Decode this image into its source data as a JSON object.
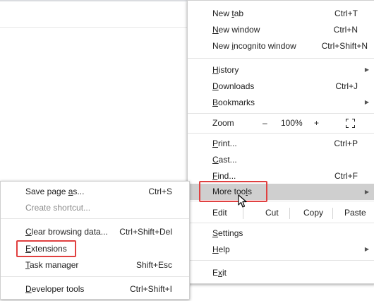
{
  "main_menu": {
    "new_tab": {
      "pre": "New ",
      "u": "t",
      "post": "ab",
      "shortcut": "Ctrl+T"
    },
    "new_window": {
      "pre": "",
      "u": "N",
      "post": "ew window",
      "shortcut": "Ctrl+N"
    },
    "new_incognito": {
      "pre": "New ",
      "u": "i",
      "post": "ncognito window",
      "shortcut": "Ctrl+Shift+N"
    },
    "history": {
      "pre": "",
      "u": "H",
      "post": "istory"
    },
    "downloads": {
      "pre": "",
      "u": "D",
      "post": "ownloads",
      "shortcut": "Ctrl+J"
    },
    "bookmarks": {
      "pre": "",
      "u": "B",
      "post": "ookmarks"
    },
    "zoom": {
      "label": "Zoom",
      "minus": "–",
      "percent": "100%",
      "plus": "+"
    },
    "print": {
      "pre": "",
      "u": "P",
      "post": "rint...",
      "shortcut": "Ctrl+P"
    },
    "cast": {
      "pre": "",
      "u": "C",
      "post": "ast..."
    },
    "find": {
      "pre": "",
      "u": "F",
      "post": "ind...",
      "shortcut": "Ctrl+F"
    },
    "more_tools": {
      "pre": "More too",
      "u": "l",
      "post": "s"
    },
    "edit": {
      "label": "Edit",
      "cut": "Cut",
      "copy": "Copy",
      "paste": "Paste"
    },
    "settings": {
      "pre": "",
      "u": "S",
      "post": "ettings"
    },
    "help": {
      "pre": "",
      "u": "H",
      "post": "elp"
    },
    "exit": {
      "pre": "E",
      "u": "x",
      "post": "it"
    }
  },
  "sub_menu": {
    "save_page": {
      "pre": "Save page ",
      "u": "a",
      "post": "s...",
      "shortcut": "Ctrl+S"
    },
    "create_shortcut": {
      "label": "Create shortcut..."
    },
    "clear_data": {
      "pre": "",
      "u": "C",
      "post": "lear browsing data...",
      "shortcut": "Ctrl+Shift+Del"
    },
    "extensions": {
      "pre": "",
      "u": "E",
      "post": "xtensions"
    },
    "task_manager": {
      "pre": "",
      "u": "T",
      "post": "ask manager",
      "shortcut": "Shift+Esc"
    },
    "developer_tools": {
      "pre": "",
      "u": "D",
      "post": "eveloper tools",
      "shortcut": "Ctrl+Shift+I"
    }
  },
  "colors": {
    "highlight_box": "#e04040",
    "hover": "#cfcfcf"
  }
}
